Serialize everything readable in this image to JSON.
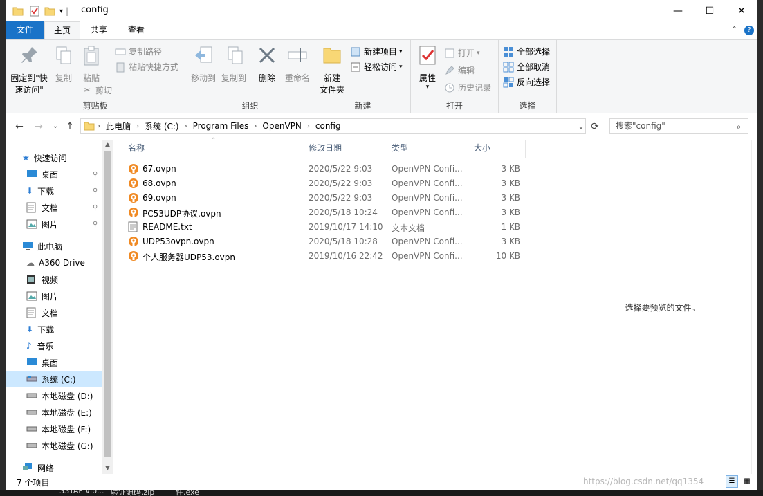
{
  "window": {
    "title": "config",
    "controls": {
      "minimize": "—",
      "maximize": "☐",
      "close": "✕"
    }
  },
  "tabs": [
    {
      "label": "文件"
    },
    {
      "label": "主页"
    },
    {
      "label": "共享"
    },
    {
      "label": "查看"
    }
  ],
  "ribbon": {
    "clipboard": {
      "pin_label_1": "固定到\"快",
      "pin_label_2": "速访问\"",
      "copy": "复制",
      "paste": "粘贴",
      "copy_path": "复制路径",
      "paste_shortcut": "粘贴快捷方式",
      "cut": "剪切",
      "group": "剪贴板"
    },
    "organize": {
      "move_to": "移动到",
      "copy_to": "复制到",
      "delete": "删除",
      "rename": "重命名",
      "group": "组织"
    },
    "new": {
      "new_folder_1": "新建",
      "new_folder_2": "文件夹",
      "new_item": "新建项目",
      "easy_access": "轻松访问",
      "group": "新建"
    },
    "open": {
      "properties": "属性",
      "open": "打开",
      "edit": "编辑",
      "history": "历史记录",
      "group": "打开"
    },
    "select": {
      "select_all": "全部选择",
      "select_none": "全部取消",
      "invert": "反向选择",
      "group": "选择"
    }
  },
  "address": {
    "crumbs": [
      "此电脑",
      "系统 (C:)",
      "Program Files",
      "OpenVPN",
      "config"
    ],
    "search_placeholder": "搜索\"config\""
  },
  "nav": {
    "quick_access": "快速访问",
    "quick_items": [
      {
        "label": "桌面",
        "icon": "desktop-icon"
      },
      {
        "label": "下载",
        "icon": "download-icon"
      },
      {
        "label": "文档",
        "icon": "documents-icon"
      },
      {
        "label": "图片",
        "icon": "pictures-icon"
      }
    ],
    "this_pc": "此电脑",
    "pc_items": [
      {
        "label": "A360 Drive"
      },
      {
        "label": "视频"
      },
      {
        "label": "图片"
      },
      {
        "label": "文档"
      },
      {
        "label": "下载"
      },
      {
        "label": "音乐"
      },
      {
        "label": "桌面"
      },
      {
        "label": "系统 (C:)"
      },
      {
        "label": "本地磁盘 (D:)"
      },
      {
        "label": "本地磁盘 (E:)"
      },
      {
        "label": "本地磁盘 (F:)"
      },
      {
        "label": "本地磁盘 (G:)"
      }
    ],
    "network": "网络"
  },
  "columns": {
    "name": "名称",
    "date": "修改日期",
    "type": "类型",
    "size": "大小"
  },
  "files": [
    {
      "name": "67.ovpn",
      "date": "2020/5/22 9:03",
      "type": "OpenVPN Confi...",
      "size": "3 KB",
      "kind": "ovpn"
    },
    {
      "name": "68.ovpn",
      "date": "2020/5/22 9:03",
      "type": "OpenVPN Confi...",
      "size": "3 KB",
      "kind": "ovpn"
    },
    {
      "name": "69.ovpn",
      "date": "2020/5/22 9:03",
      "type": "OpenVPN Confi...",
      "size": "3 KB",
      "kind": "ovpn"
    },
    {
      "name": "PC53UDP协议.ovpn",
      "date": "2020/5/18 10:24",
      "type": "OpenVPN Confi...",
      "size": "3 KB",
      "kind": "ovpn"
    },
    {
      "name": "README.txt",
      "date": "2019/10/17 14:10",
      "type": "文本文档",
      "size": "1 KB",
      "kind": "txt"
    },
    {
      "name": "UDP53ovpn.ovpn",
      "date": "2020/5/18 10:28",
      "type": "OpenVPN Confi...",
      "size": "3 KB",
      "kind": "ovpn"
    },
    {
      "name": "个人服务器UDP53.ovpn",
      "date": "2019/10/16 22:42",
      "type": "OpenVPN Confi...",
      "size": "10 KB",
      "kind": "ovpn"
    }
  ],
  "preview": {
    "text": "选择要预览的文件。"
  },
  "status": {
    "count": "7 个项目"
  },
  "watermark": "https://blog.csdn.net/qq1354",
  "taskbar": {
    "items": [
      "SSTAP vip...",
      "验证源码.zip",
      "件.exe"
    ]
  }
}
